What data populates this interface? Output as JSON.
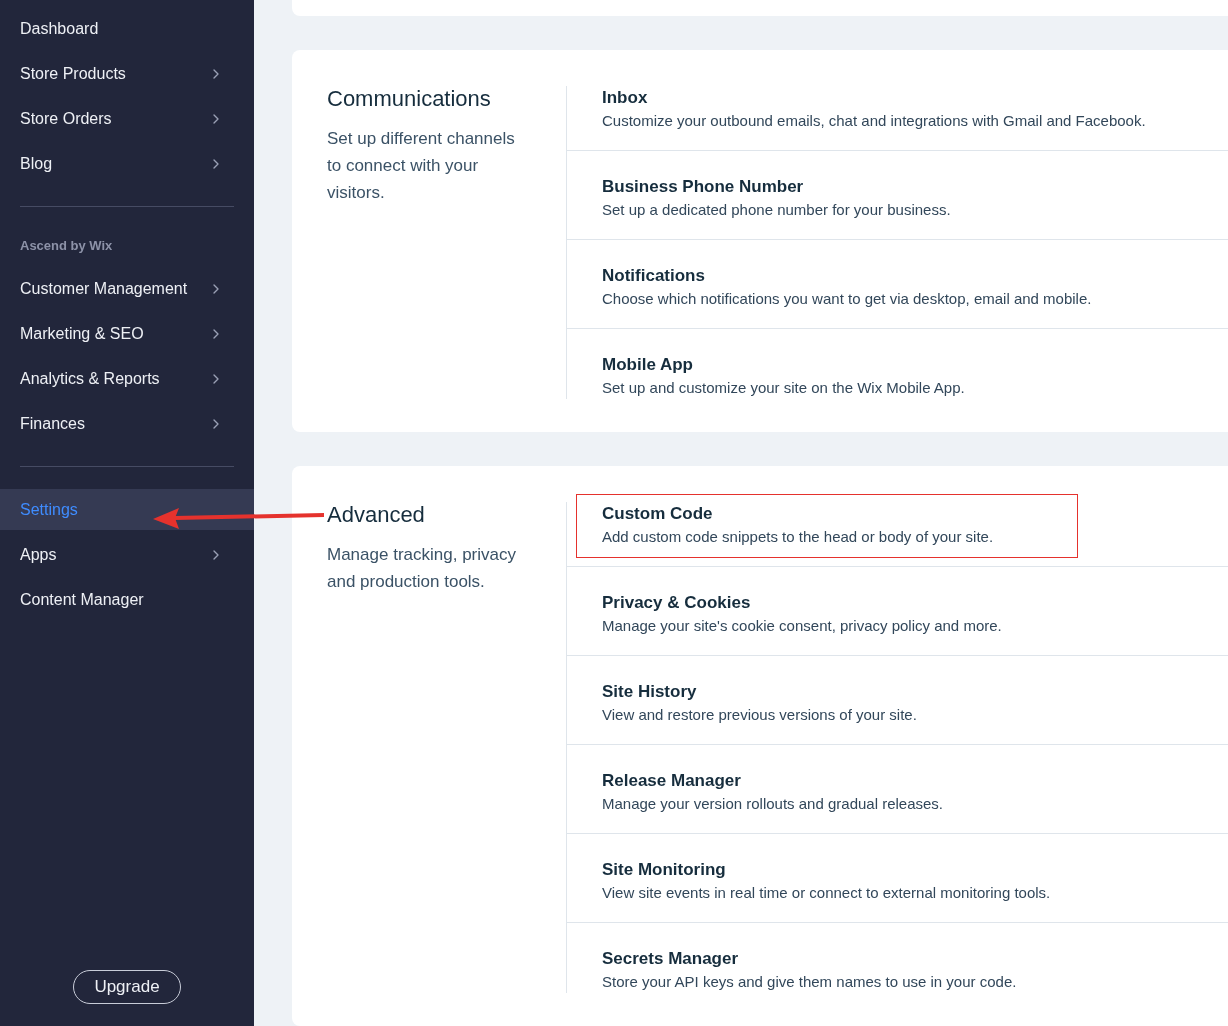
{
  "sidebar": {
    "groups": [
      {
        "items": [
          {
            "label": "Dashboard",
            "chevron": false,
            "selected": false
          },
          {
            "label": "Store Products",
            "chevron": true,
            "selected": false
          },
          {
            "label": "Store Orders",
            "chevron": true,
            "selected": false
          },
          {
            "label": "Blog",
            "chevron": true,
            "selected": false
          }
        ]
      },
      {
        "label": "Ascend by Wix",
        "items": [
          {
            "label": "Customer Management",
            "chevron": true,
            "selected": false
          },
          {
            "label": "Marketing & SEO",
            "chevron": true,
            "selected": false
          },
          {
            "label": "Analytics & Reports",
            "chevron": true,
            "selected": false
          },
          {
            "label": "Finances",
            "chevron": true,
            "selected": false
          }
        ]
      },
      {
        "items": [
          {
            "label": "Settings",
            "chevron": false,
            "selected": true
          },
          {
            "label": "Apps",
            "chevron": true,
            "selected": false
          },
          {
            "label": "Content Manager",
            "chevron": false,
            "selected": false
          }
        ]
      }
    ],
    "upgrade_button": "Upgrade"
  },
  "sections": [
    {
      "title": "Communications",
      "description": "Set up different channels to connect with your visitors.",
      "items": [
        {
          "title": "Inbox",
          "description": "Customize your outbound emails, chat and integrations with Gmail and Facebook.",
          "highlighted": false
        },
        {
          "title": "Business Phone Number",
          "description": "Set up a dedicated phone number for your business.",
          "highlighted": false
        },
        {
          "title": "Notifications",
          "description": "Choose which notifications you want to get via desktop, email and mobile.",
          "highlighted": false
        },
        {
          "title": "Mobile App",
          "description": "Set up and customize your site on the Wix Mobile App.",
          "highlighted": false
        }
      ]
    },
    {
      "title": "Advanced",
      "description": "Manage tracking, privacy and production tools.",
      "items": [
        {
          "title": "Custom Code",
          "description": "Add custom code snippets to the head or body of your site.",
          "highlighted": true
        },
        {
          "title": "Privacy & Cookies",
          "description": "Manage your site's cookie consent, privacy policy and more.",
          "highlighted": false
        },
        {
          "title": "Site History",
          "description": "View and restore previous versions of your site.",
          "highlighted": false
        },
        {
          "title": "Release Manager",
          "description": "Manage your version rollouts and gradual releases.",
          "highlighted": false
        },
        {
          "title": "Site Monitoring",
          "description": "View site events in real time or connect to external monitoring tools.",
          "highlighted": false
        },
        {
          "title": "Secrets Manager",
          "description": "Store your API keys and give them names to use in your code.",
          "highlighted": false
        }
      ]
    }
  ],
  "annotation": {
    "arrow": true
  }
}
